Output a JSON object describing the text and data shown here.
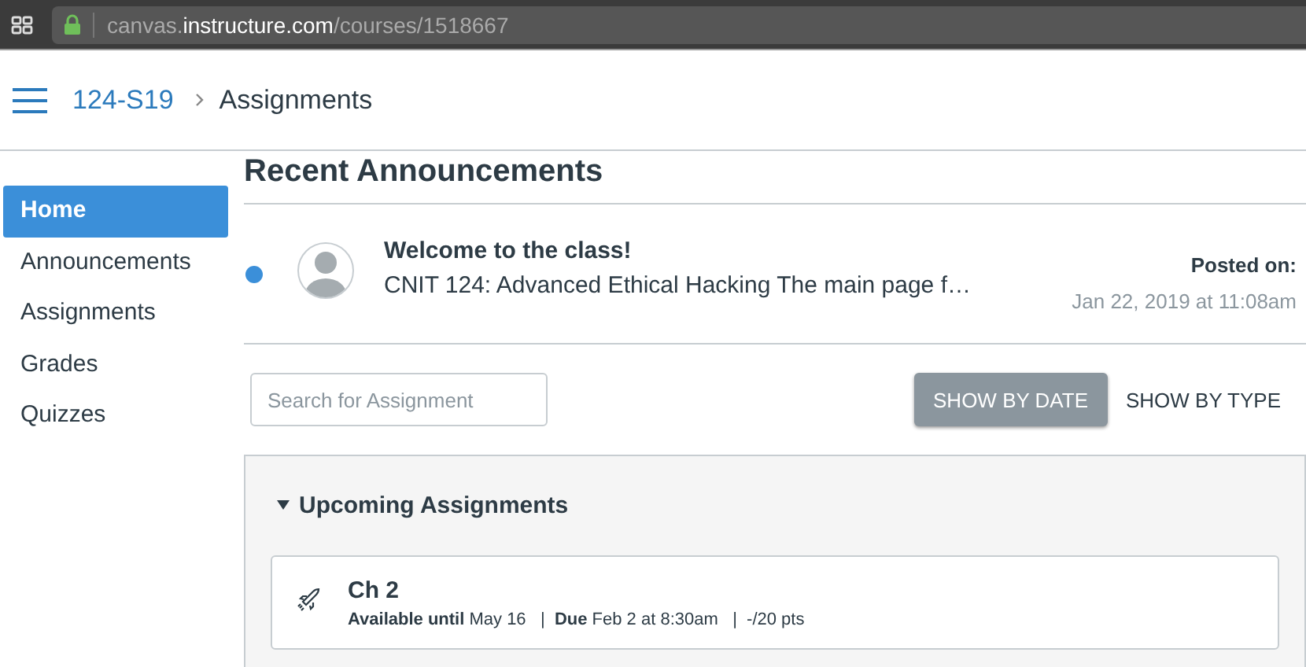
{
  "browser": {
    "url_prefix": "canvas.",
    "url_domain": "instructure.com",
    "url_path": "/courses/1518667"
  },
  "breadcrumb": [
    "124-S19",
    "Assignments"
  ],
  "sidebar": {
    "items": [
      {
        "label": "Home",
        "selected": true
      },
      {
        "label": "Announcements",
        "selected": false
      },
      {
        "label": "Assignments",
        "selected": false
      },
      {
        "label": "Grades",
        "selected": false
      },
      {
        "label": "Quizzes",
        "selected": false
      }
    ]
  },
  "announcements": {
    "title": "Recent Announcements",
    "items": [
      {
        "unread": true,
        "title": "Welcome to the class!",
        "preview": "CNIT 124: Advanced Ethical Hacking The main page f…",
        "posted_label": "Posted on:",
        "posted_date": "Jan 22, 2019 at 11:08am"
      }
    ]
  },
  "search": {
    "placeholder": "Search for Assignment"
  },
  "view_buttons": [
    {
      "label": "SHOW BY DATE",
      "selected": true
    },
    {
      "label": "SHOW BY TYPE",
      "selected": false
    }
  ],
  "groups": [
    {
      "title": "Upcoming Assignments",
      "expanded": true,
      "assignments": [
        {
          "title": "Ch 2",
          "details": "**Available until** May 16   |  **Due** Feb 2 at 8:30am   |  -/20 pts"
        }
      ]
    }
  ]
}
